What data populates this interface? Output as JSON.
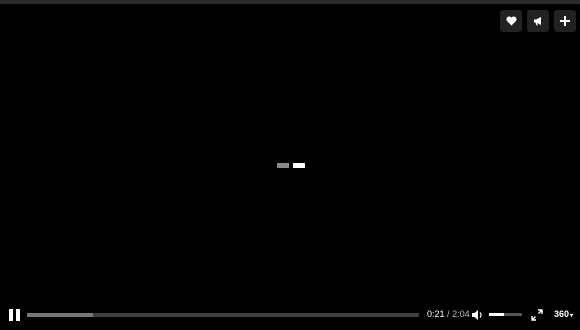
{
  "player": {
    "side_actions": [
      {
        "icon": "heart-icon",
        "label": "like"
      },
      {
        "icon": "megaphone-icon",
        "label": "share"
      },
      {
        "icon": "plus-icon",
        "label": "add"
      }
    ],
    "playback": {
      "state": "playing",
      "current_time": "0:21",
      "separator": "/",
      "duration": "2:04",
      "progress_fraction": 0.169
    },
    "volume": {
      "level_fraction": 0.45
    },
    "quality": {
      "label": "360",
      "caret": "▾"
    }
  }
}
